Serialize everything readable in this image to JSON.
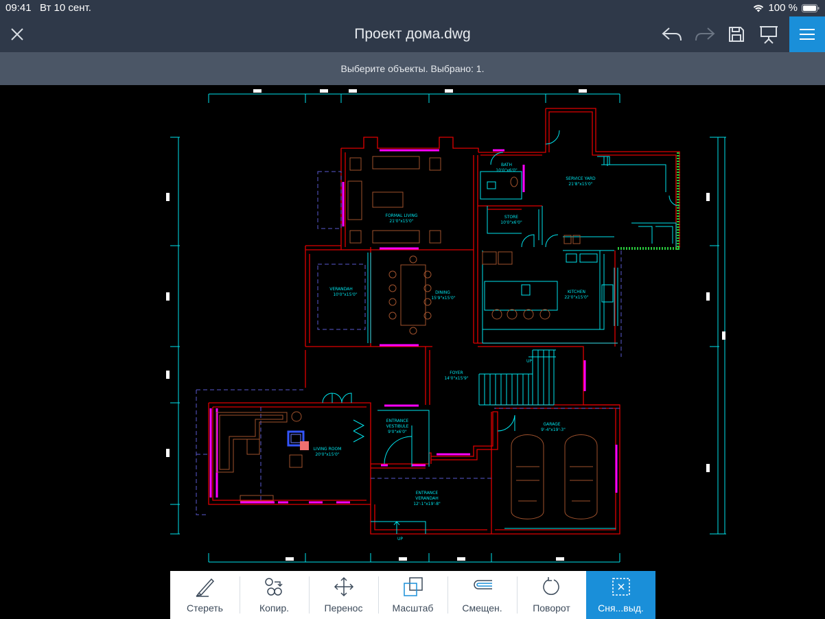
{
  "status": {
    "time": "09:41",
    "date": "Вт 10 сент.",
    "battery": "100 %"
  },
  "header": {
    "title": "Проект дома.dwg"
  },
  "hint": "Выберите объекты. Выбрано: 1.",
  "rooms": {
    "formal_living": "FORMAL LIVING",
    "formal_living_dim": "21'0\"x15'0\"",
    "bath": "BATH",
    "bath_dim": "10'0\"x6'0\"",
    "service_yard": "SERVICE YARD",
    "service_yard_dim": "21'8\"x15'0\"",
    "store": "STORE",
    "store_dim": "10'0\"x6'0\"",
    "verandah": "VERANDAH",
    "verandah_dim": "10'0\"x15'0\"",
    "dining": "DINING",
    "dining_dim": "15'9\"x15'0\"",
    "kitchen": "KITCHEN",
    "kitchen_dim": "22'0\"x15'0\"",
    "foyer": "FOYER",
    "foyer_dim": "14'0\"x15'9\"",
    "entrance_vestibule": "ENTRANCE",
    "entrance_vestibule_2": "VESTIBULE",
    "entrance_vestibule_dim": "9'0\"x6'0\"",
    "living_room": "LIVING ROOM",
    "living_room_dim": "20'0\"x15'0\"",
    "garage": "GARAGE",
    "garage_dim": "9'-4\"x19'-3\"",
    "entrance_verandah": "ENTRANCE",
    "entrance_verandah_2": "VERANDAH",
    "entrance_verandah_dim": "12'-1\"x19'-8\"",
    "up1": "UP",
    "up2": "UP"
  },
  "toolbar": [
    {
      "label": "Стереть",
      "icon": "eraser-icon"
    },
    {
      "label": "Копир.",
      "icon": "copy-icon"
    },
    {
      "label": "Перенос",
      "icon": "move-icon"
    },
    {
      "label": "Масштаб",
      "icon": "scale-icon"
    },
    {
      "label": "Смещен.",
      "icon": "offset-icon"
    },
    {
      "label": "Поворот",
      "icon": "rotate-icon"
    },
    {
      "label": "Сня...выд.",
      "icon": "deselect-icon"
    }
  ],
  "colors": {
    "accent": "#1a8fd9",
    "bar": "#2f3949",
    "hint_bar": "#4b5666",
    "wall": "#e00000",
    "window": "#ff00ff",
    "cyan": "#00e5ee",
    "furniture": "#a0522d",
    "selection": "#3355ff",
    "grip": "#f07070"
  }
}
